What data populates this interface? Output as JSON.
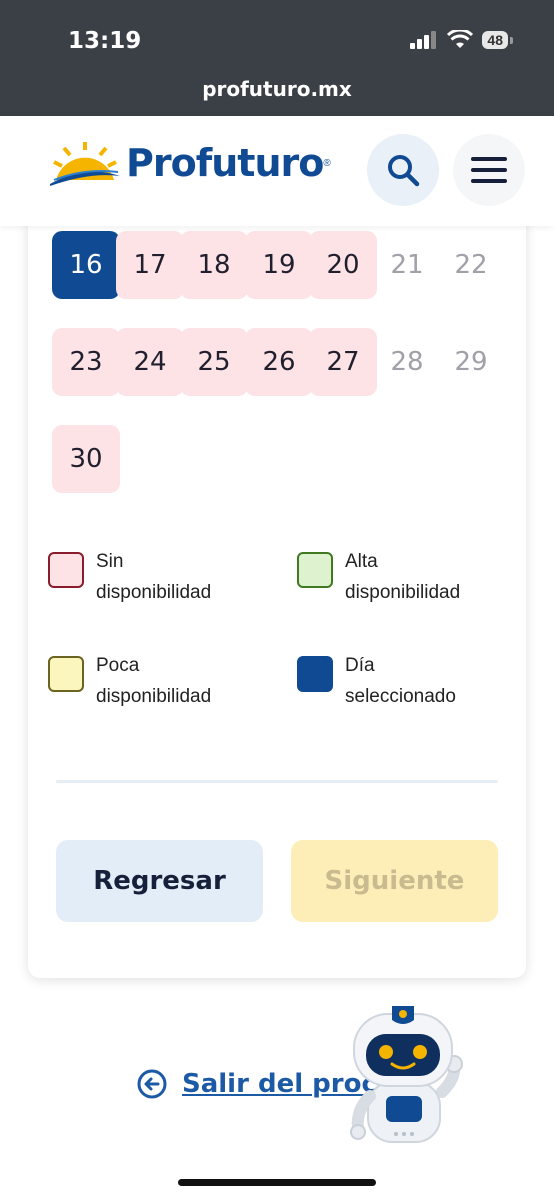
{
  "status_bar": {
    "time": "13:19",
    "battery": "48",
    "url": "profuturo.mx"
  },
  "header": {
    "logo_text": "Profuturo",
    "logo_reg": "®",
    "search_icon": "search-icon",
    "menu_icon": "hamburger-menu-icon"
  },
  "calendar": {
    "days": [
      {
        "label": "16",
        "status": "selected"
      },
      {
        "label": "17",
        "status": "low"
      },
      {
        "label": "18",
        "status": "low"
      },
      {
        "label": "19",
        "status": "low"
      },
      {
        "label": "20",
        "status": "low"
      },
      {
        "label": "21",
        "status": "off"
      },
      {
        "label": "22",
        "status": "off"
      },
      {
        "label": "23",
        "status": "low"
      },
      {
        "label": "24",
        "status": "low"
      },
      {
        "label": "25",
        "status": "low"
      },
      {
        "label": "26",
        "status": "low"
      },
      {
        "label": "27",
        "status": "low"
      },
      {
        "label": "28",
        "status": "off"
      },
      {
        "label": "29",
        "status": "off"
      },
      {
        "label": "30",
        "status": "low"
      }
    ]
  },
  "legend": {
    "none_line1": "Sin",
    "none_line2": "disponibilidad",
    "high_line1": "Alta",
    "high_line2": "disponibilidad",
    "low_line1": "Poca",
    "low_line2": "disponibilidad",
    "selected_line1": "Día",
    "selected_line2": "seleccionado",
    "colors": {
      "none": "#fde3e6",
      "none_border": "#8b1c2c",
      "high": "#dff2cf",
      "high_border": "#3f7a22",
      "low": "#fbf6bd",
      "low_border": "#6b6420",
      "selected": "#0f4a93"
    }
  },
  "buttons": {
    "back": "Regresar",
    "next": "Siguiente"
  },
  "exit": {
    "label": "Salir del proc",
    "icon": "arrow-left-circle-icon"
  },
  "colors": {
    "brand": "#0f4a93",
    "accent": "#f5b400"
  }
}
